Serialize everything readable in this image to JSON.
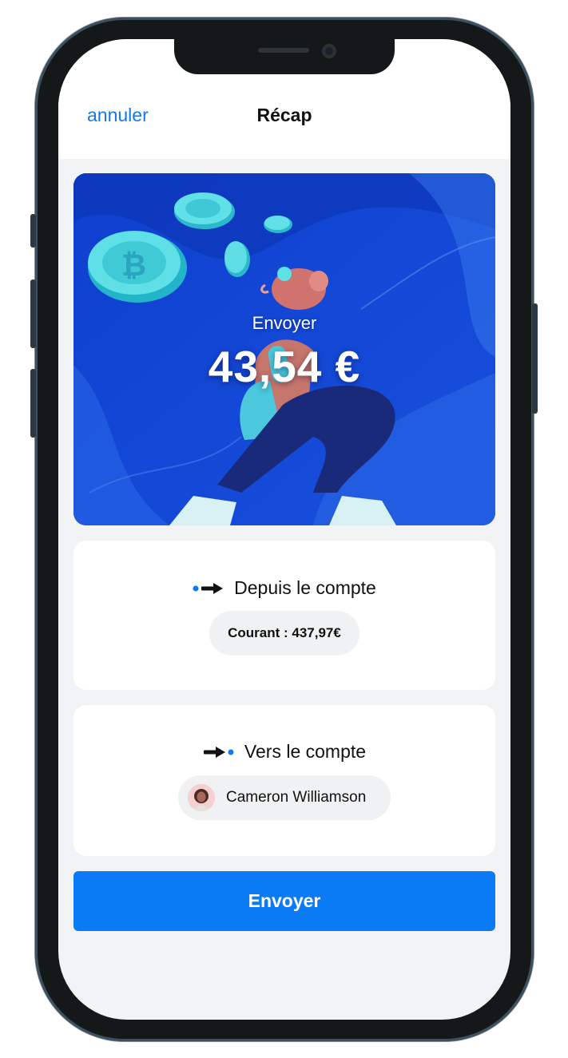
{
  "header": {
    "cancel_label": "annuler",
    "title": "Récap"
  },
  "hero": {
    "label": "Envoyer",
    "amount": "43,54 €"
  },
  "from_account": {
    "title": "Depuis le compte",
    "balance_label": "Courant : 437,97€",
    "icon": "dot-arrow-out-icon"
  },
  "to_account": {
    "title": "Vers le compte",
    "recipient_name": "Cameron Williamson",
    "icon": "arrow-dot-in-icon"
  },
  "actions": {
    "send_label": "Envoyer"
  },
  "colors": {
    "accent": "#0a7bf5",
    "link": "#1479e8",
    "hero_background": "#1447d6",
    "screen_background": "#f2f3f5"
  }
}
